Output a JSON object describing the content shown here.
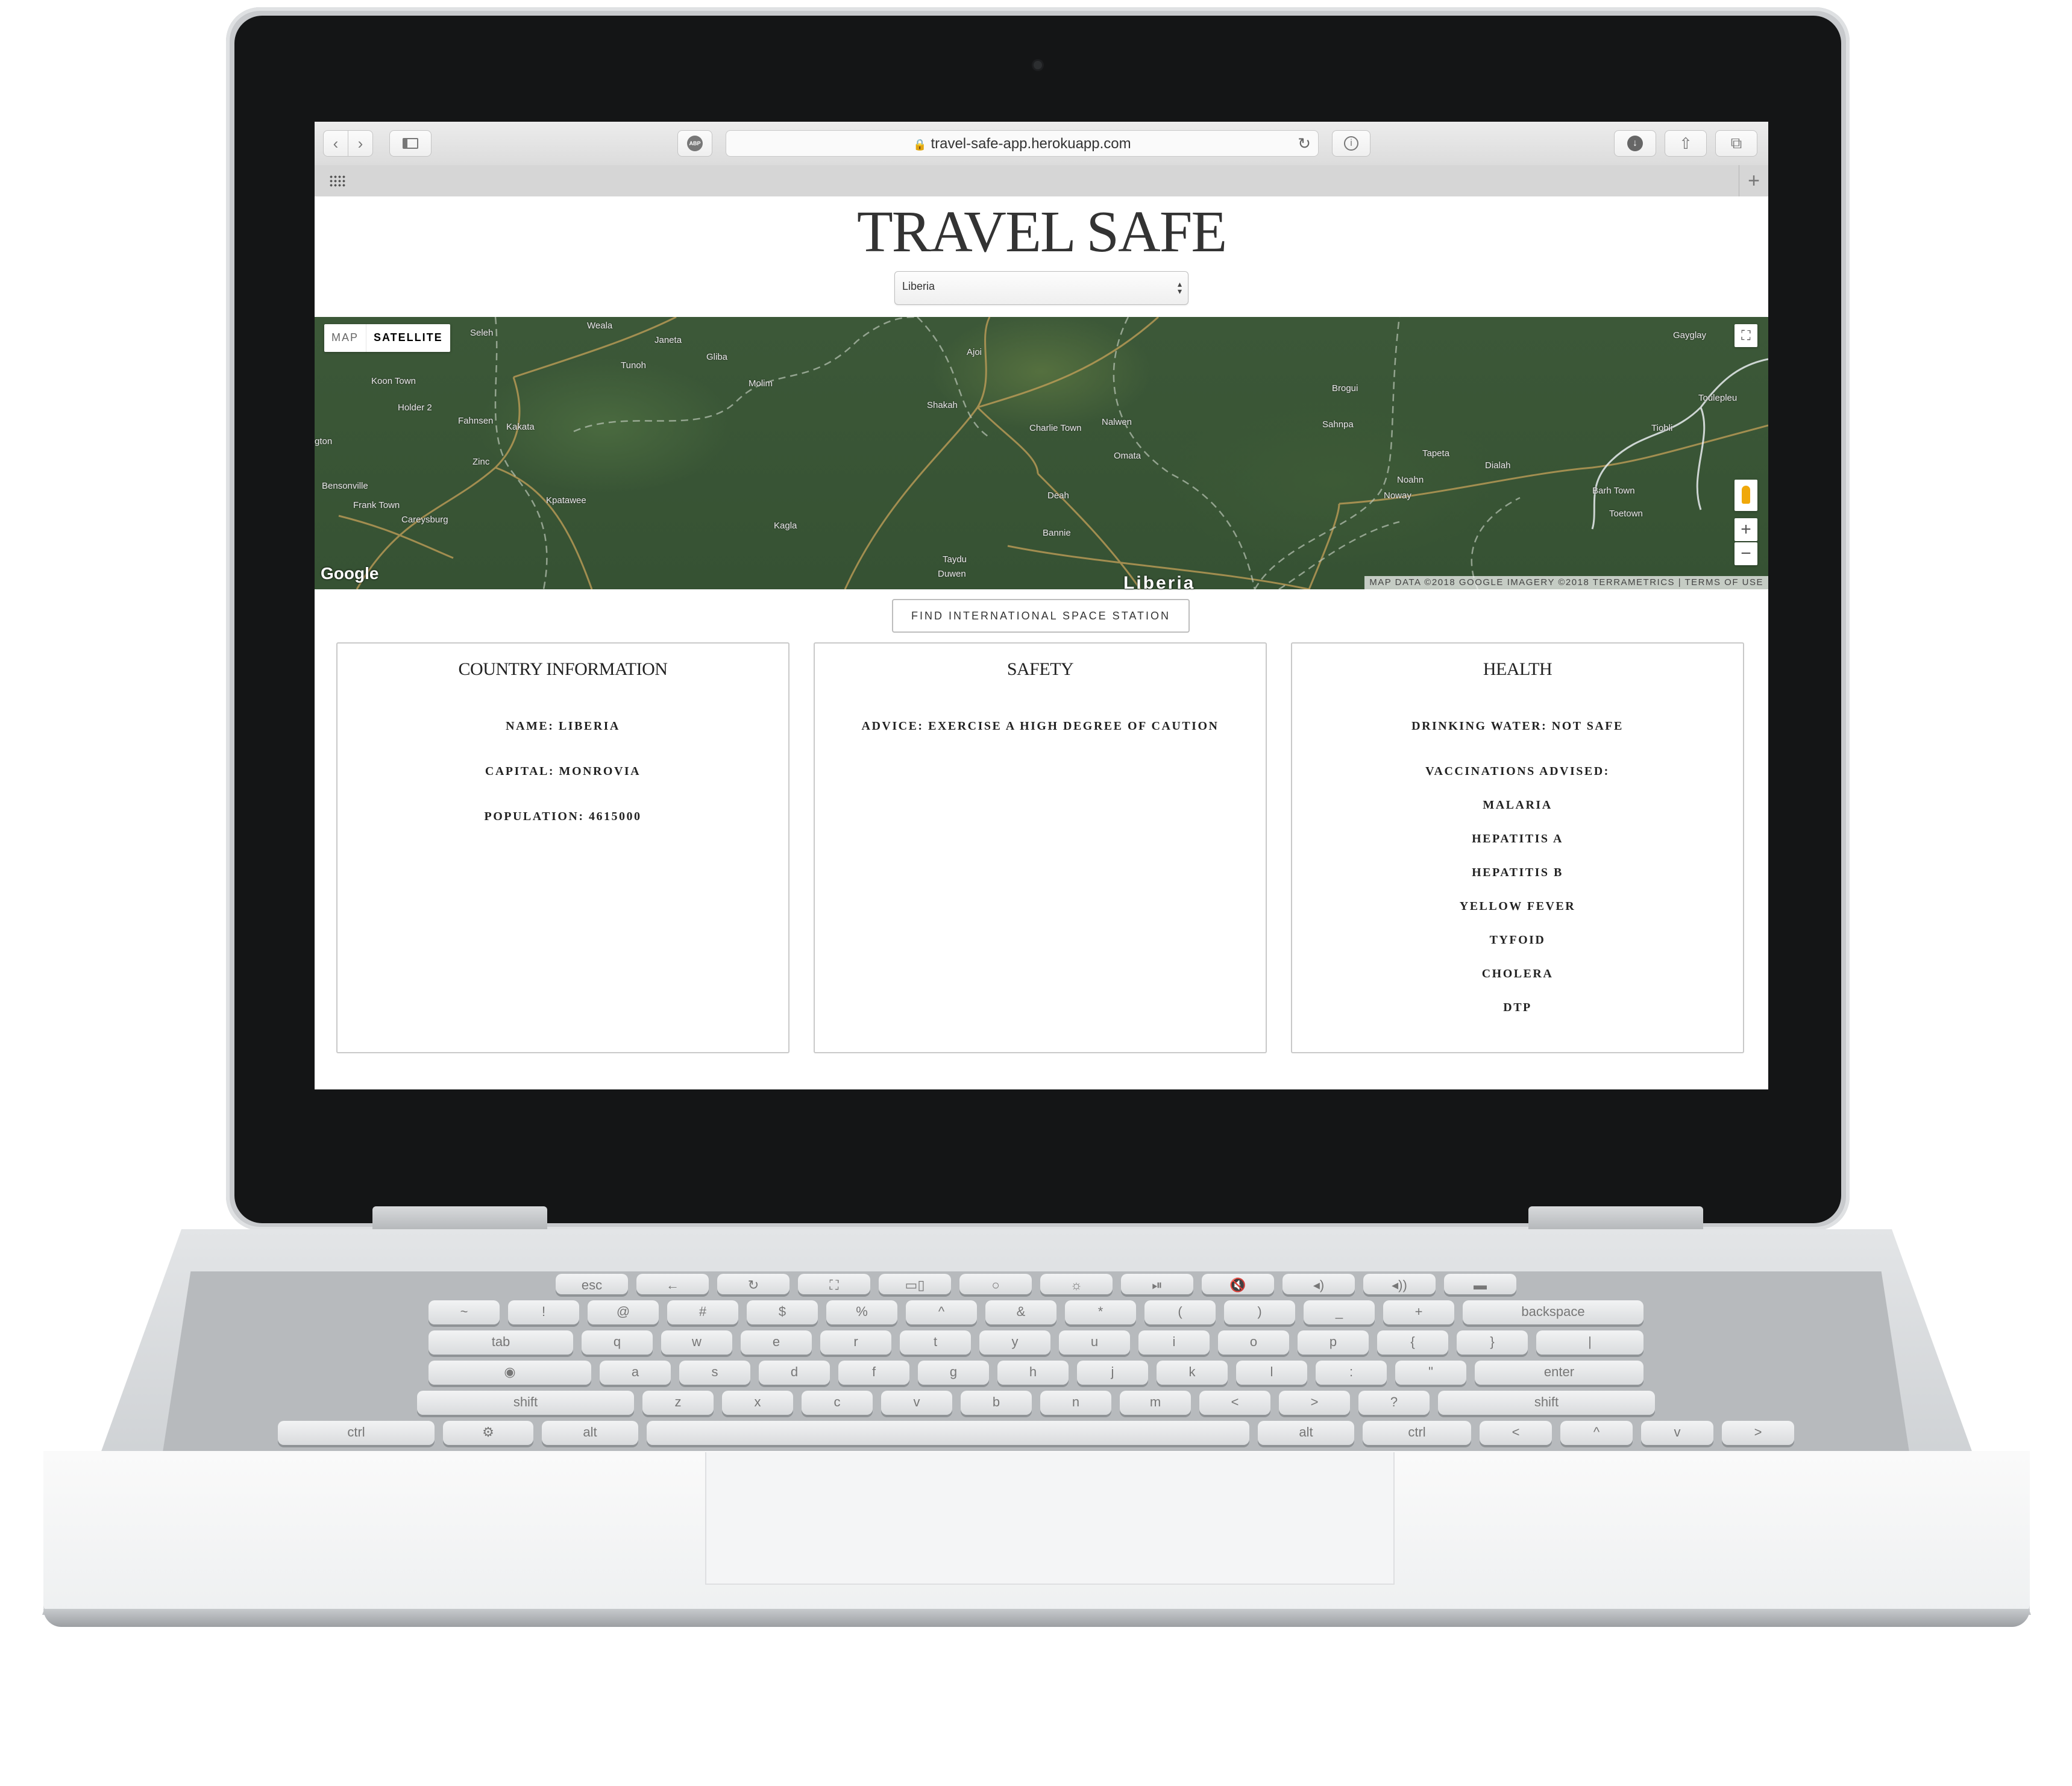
{
  "browser": {
    "url": "travel-safe-app.herokuapp.com",
    "adblock_label": "ABP"
  },
  "site": {
    "title": "TRAVEL SAFE",
    "selected_country": "Liberia"
  },
  "map": {
    "type_options": [
      "MAP",
      "SATELLITE"
    ],
    "selected_type": "SATELLITE",
    "country_label": "Liberia",
    "logo": "Google",
    "attribution": "MAP DATA ©2018 GOOGLE IMAGERY ©2018 TERRAMETRICS | TERMS OF USE",
    "places": [
      "Seleh",
      "Weala",
      "Janeta",
      "Tunoh",
      "Gliba",
      "Koon Town",
      "Molim",
      "Ajoi",
      "Holder 2",
      "Fahnsen",
      "Kakata",
      "Shakah",
      "Charlie Town",
      "Nalwen",
      "Brogui",
      "Sahnpa",
      "Zinc",
      "Omata",
      "Tapeta",
      "Dialah",
      "Noahn",
      "Bensonville",
      "Frank Town",
      "Kpatawee",
      "Deah",
      "Noway",
      "Barh Town",
      "Toetown",
      "Careysburg",
      "Kagla",
      "Bannie",
      "Taydu",
      "Duwen",
      "Gayglay",
      "Toulepleu",
      "Tiobli",
      "gton"
    ],
    "zoom_in": "+",
    "zoom_out": "−"
  },
  "actions": {
    "iss_button": "FIND INTERNATIONAL SPACE STATION"
  },
  "cards": {
    "country": {
      "title": "COUNTRY INFORMATION",
      "name": "NAME: LIBERIA",
      "capital": "CAPITAL: MONROVIA",
      "population": "POPULATION: 4615000"
    },
    "safety": {
      "title": "SAFETY",
      "advice": "ADVICE: EXERCISE A HIGH DEGREE OF CAUTION"
    },
    "health": {
      "title": "HEALTH",
      "water": "DRINKING WATER: NOT SAFE",
      "vaccinations_label": "VACCINATIONS ADVISED:",
      "vaccinations": [
        "MALARIA",
        "HEPATITIS A",
        "HEPATITIS B",
        "YELLOW FEVER",
        "TYFOID",
        "CHOLERA",
        "DTP"
      ]
    }
  },
  "keyboard": {
    "row1": [
      "esc",
      "←",
      "↻",
      "⛶",
      "▭▯",
      "○",
      "☼",
      "⏯",
      "🔇",
      "◂)",
      "◂))",
      "▬"
    ],
    "row2": [
      "~",
      "!",
      "@",
      "#",
      "$",
      "%",
      "^",
      "&",
      "*",
      "(",
      ")",
      "_",
      "+",
      "backspace"
    ],
    "row3": [
      "tab",
      "q",
      "w",
      "e",
      "r",
      "t",
      "y",
      "u",
      "i",
      "o",
      "p",
      "{",
      "}",
      "|"
    ],
    "row4": [
      "◉",
      "a",
      "s",
      "d",
      "f",
      "g",
      "h",
      "j",
      "k",
      "l",
      ":",
      "\"",
      "enter"
    ],
    "row5": [
      "shift",
      "z",
      "x",
      "c",
      "v",
      "b",
      "n",
      "m",
      "<",
      ">",
      "?",
      "shift"
    ],
    "row6": [
      "ctrl",
      "⚙",
      "alt",
      "",
      "alt",
      "ctrl",
      "<",
      "^",
      "v",
      ">"
    ]
  }
}
